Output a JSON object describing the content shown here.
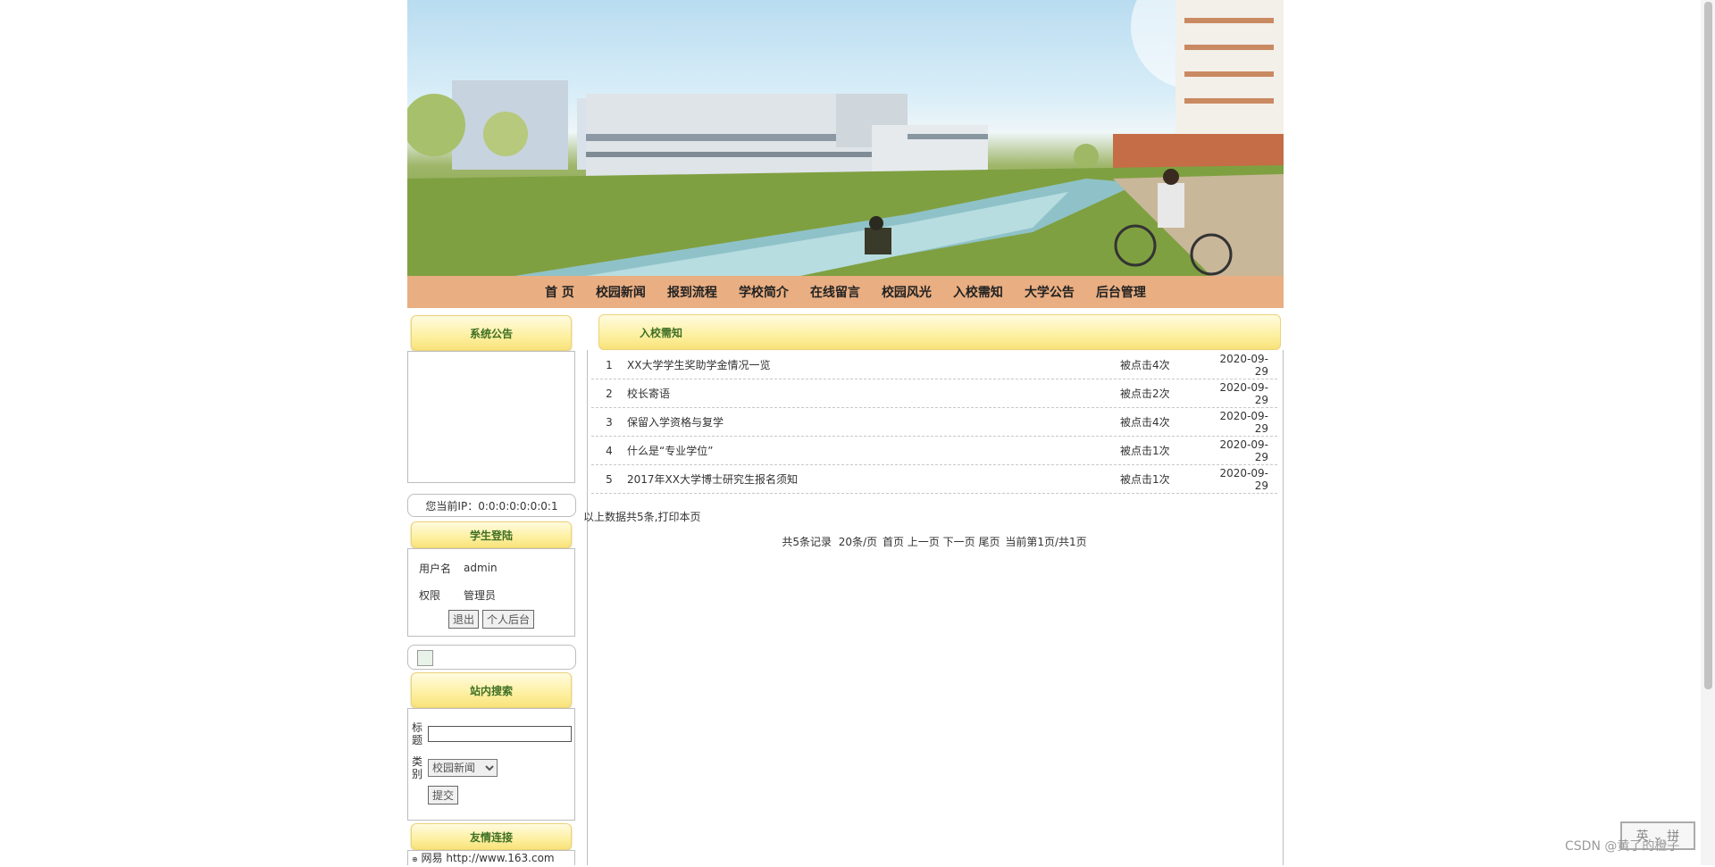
{
  "nav": [
    "首 页",
    "校园新闻",
    "报到流程",
    "学校简介",
    "在线留言",
    "校园风光",
    "入校需知",
    "大学公告",
    "后台管理"
  ],
  "left": {
    "notice_title": "系统公告",
    "ip_text": "您当前IP：0:0:0:0:0:0:0:1",
    "login_title": "学生登陆",
    "login": {
      "user_label": "用户名",
      "user_value": "admin",
      "role_label": "权限",
      "role_value": "管理员",
      "logout_label": "退出",
      "backend_label": "个人后台"
    },
    "search_title": "站内搜索",
    "search": {
      "title_label": "标题",
      "type_label": "类别",
      "type_selected": "校园新闻",
      "submit_label": "提交"
    },
    "links_title": "友情连接",
    "links_first": "网易 http://www.163.com"
  },
  "main": {
    "title": "入校需知",
    "rows": [
      {
        "idx": "1",
        "title": "XX大学学生奖助学金情况一览",
        "clicks": "被点击4次",
        "date": "2020-09-29"
      },
      {
        "idx": "2",
        "title": "校长寄语",
        "clicks": "被点击2次",
        "date": "2020-09-29"
      },
      {
        "idx": "3",
        "title": "保留入学资格与复学",
        "clicks": "被点击4次",
        "date": "2020-09-29"
      },
      {
        "idx": "4",
        "title": "什么是“专业学位”",
        "clicks": "被点击1次",
        "date": "2020-09-29"
      },
      {
        "idx": "5",
        "title": "2017年XX大学博士研究生报名须知",
        "clicks": "被点击1次",
        "date": "2020-09-29"
      }
    ],
    "summary": "以上数据共5条,打印本页",
    "pager": {
      "total": "共5条记录",
      "per_page": "20条/页",
      "first": "首页",
      "prev": "上一页",
      "next": "下一页",
      "last": "尾页",
      "status": "当前第1页/共1页"
    }
  },
  "watermark": "CSDN @黄了的橙子",
  "colors": {
    "nav_bg": "#e9ae82",
    "title_bg": "#fdf0a0",
    "title_text": "#3e6f24"
  }
}
